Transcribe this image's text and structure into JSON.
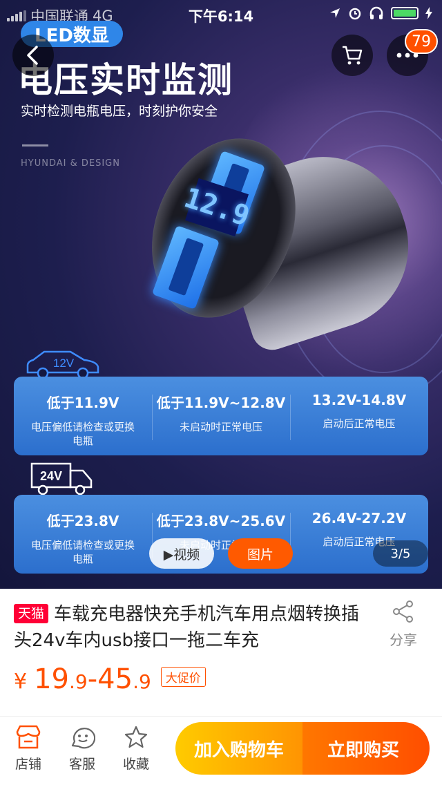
{
  "status_bar": {
    "carrier": "中国联通",
    "network": "4G",
    "time": "下午6:14"
  },
  "hero": {
    "led_tag": "LED数显",
    "title": "电压实时监测",
    "subtitle": "实时检测电瓶电压，时刻护你安全",
    "brand": "HYUNDAI & DESIGN",
    "display_digits": "12.9",
    "car_label": "12V",
    "truck_label": "24V",
    "cart_badge": "79"
  },
  "card_12v": [
    {
      "value": "低于11.9V",
      "desc": "电压偏低请检查或更换电瓶"
    },
    {
      "value": "低于11.9V~12.8V",
      "desc": "未启动时正常电压"
    },
    {
      "value": "13.2V-14.8V",
      "desc": "启动后正常电压"
    }
  ],
  "card_24v": [
    {
      "value": "低于23.8V",
      "desc": "电压偏低请检查或更换电瓶"
    },
    {
      "value": "低于23.8V~25.6V",
      "desc": "未启动时正常电压"
    },
    {
      "value": "26.4V-27.2V",
      "desc": "启动后正常电压"
    }
  ],
  "media": {
    "video_label": "▶视频",
    "image_label": "图片",
    "page_indicator": "3/5"
  },
  "product": {
    "tmall_tag": "天猫",
    "title": "车载充电器快充手机汽车用点烟转换插头24v车内usb接口一拖二车充",
    "share_label": "分享",
    "currency": "¥",
    "price_low": "19",
    "price_low_dec": ".9",
    "price_sep": "-",
    "price_high": "45",
    "price_high_dec": ".9",
    "promo": "大促价"
  },
  "bottom_bar": {
    "store": "店铺",
    "service": "客服",
    "favorite": "收藏",
    "add_to_cart": "加入购物车",
    "buy_now": "立即购买"
  },
  "colors": {
    "accent": "#ff5000",
    "tmall_red": "#ff0036",
    "card_blue": "#2c6fcd"
  }
}
